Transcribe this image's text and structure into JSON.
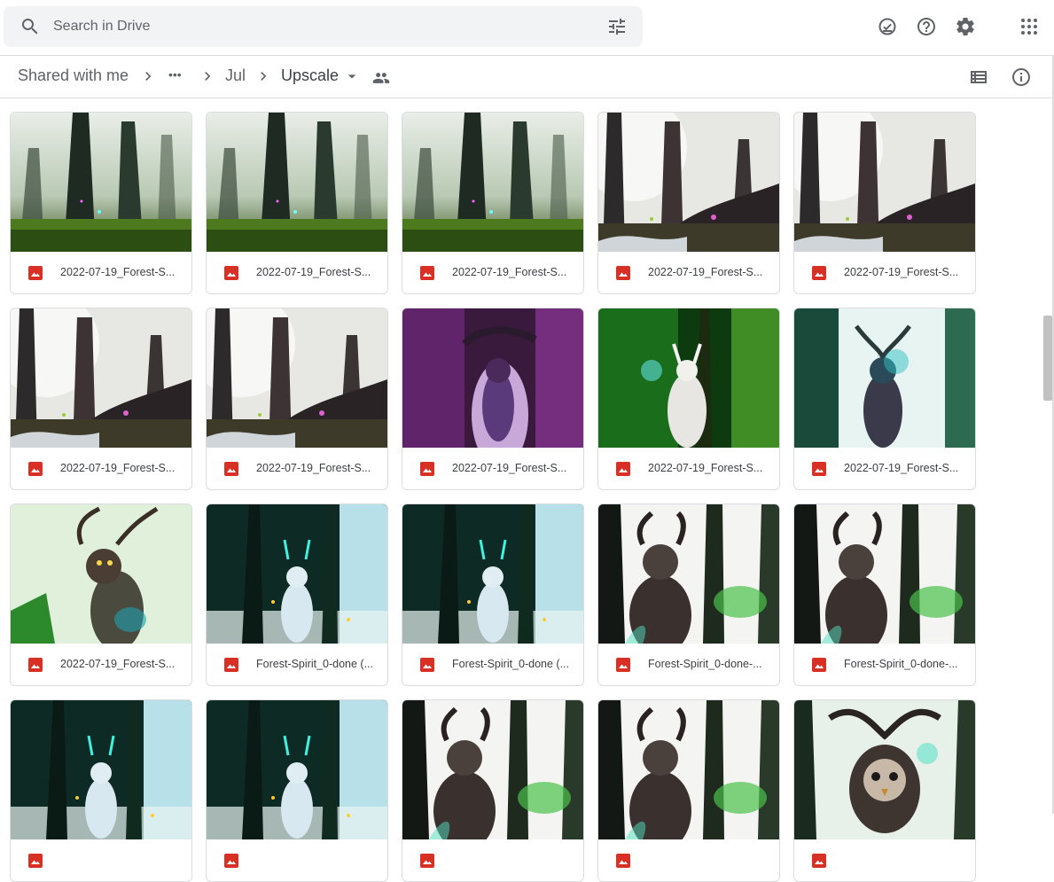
{
  "search": {
    "placeholder": "Search in Drive",
    "icon": "search-icon",
    "options_icon": "tune-icon"
  },
  "header_icons": [
    "offline-ready-icon",
    "help-icon",
    "settings-icon",
    "apps-grid-icon"
  ],
  "breadcrumb": {
    "items": [
      "Shared with me",
      "•••",
      "Jul",
      "Upscale"
    ],
    "current": "Upscale",
    "current_menu_icon": "caret-down-icon",
    "shared_icon": "people-icon"
  },
  "toolbar_icons": [
    "list-view-icon",
    "info-icon"
  ],
  "colors": {
    "search_bg": "#f1f3f4",
    "image_icon": "#d93025",
    "border": "#dadce0",
    "text": "#3c4043",
    "muted": "#5f6368"
  },
  "files": [
    {
      "name": "2022-07-19_Forest-S...",
      "thumb": "misty-green"
    },
    {
      "name": "2022-07-19_Forest-S...",
      "thumb": "misty-green"
    },
    {
      "name": "2022-07-19_Forest-S...",
      "thumb": "misty-green"
    },
    {
      "name": "2022-07-19_Forest-S...",
      "thumb": "white-forest"
    },
    {
      "name": "2022-07-19_Forest-S...",
      "thumb": "white-forest"
    },
    {
      "name": "2022-07-19_Forest-S...",
      "thumb": "white-forest"
    },
    {
      "name": "2022-07-19_Forest-S...",
      "thumb": "white-forest"
    },
    {
      "name": "2022-07-19_Forest-S...",
      "thumb": "purple-spirit"
    },
    {
      "name": "2022-07-19_Forest-S...",
      "thumb": "green-white-spirit"
    },
    {
      "name": "2022-07-19_Forest-S...",
      "thumb": "teal-spirit"
    },
    {
      "name": "2022-07-19_Forest-S...",
      "thumb": "bright-green-spirit"
    },
    {
      "name": "Forest-Spirit_0-done (...",
      "thumb": "blue-spirit"
    },
    {
      "name": "Forest-Spirit_0-done (...",
      "thumb": "blue-spirit"
    },
    {
      "name": "Forest-Spirit_0-done-...",
      "thumb": "dark-spirit"
    },
    {
      "name": "Forest-Spirit_0-done-...",
      "thumb": "dark-spirit"
    },
    {
      "name": "",
      "thumb": "blue-spirit"
    },
    {
      "name": "",
      "thumb": "blue-spirit"
    },
    {
      "name": "",
      "thumb": "dark-spirit"
    },
    {
      "name": "",
      "thumb": "dark-spirit"
    },
    {
      "name": "",
      "thumb": "owl-spirit"
    }
  ]
}
